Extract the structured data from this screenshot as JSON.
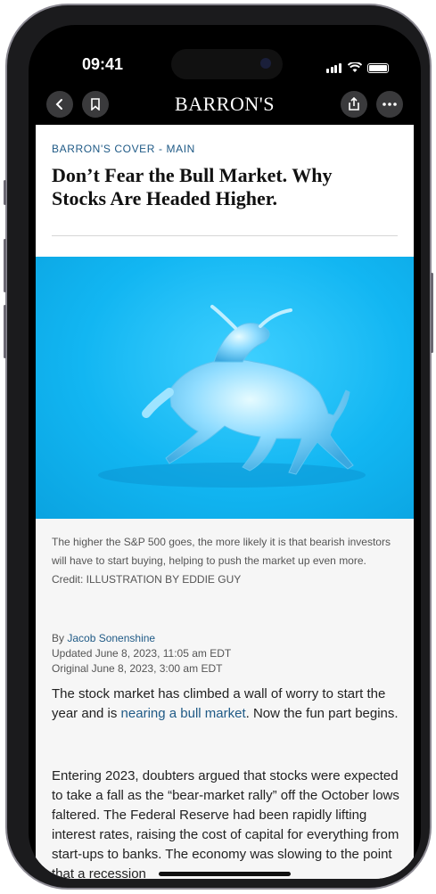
{
  "status": {
    "time": "09:41"
  },
  "nav": {
    "brand": "BARRON'S"
  },
  "article": {
    "kicker": "BARRON'S COVER - MAIN",
    "headline": "Don’t Fear the Bull Market. Why Stocks Are Headed Higher.",
    "caption": "The higher the S&P 500 goes, the more likely it is that bearish investors will have to start buying, helping to push the market up even more. Credit: ILLUSTRATION BY EDDIE GUY",
    "byline_prefix": "By ",
    "author": "Jacob Sonenshine",
    "updated": "Updated June 8, 2023, 11:05 am EDT",
    "original": "Original June 8, 2023, 3:00 am EDT",
    "para1_pre": "The stock market has climbed a wall of worry to start the year and is ",
    "para1_link": "nearing a bull market",
    "para1_post": ". Now the fun part begins.",
    "para2": "Entering 2023, doubters argued that stocks were expected to take a fall as the “bear-market rally” off the October lows faltered. The Federal Reserve had been rapidly lifting interest rates, raising the cost of capital for everything from start-ups to banks. The economy was slowing to the point that a recession"
  },
  "icons": {
    "back": "chevron-left-icon",
    "bookmark": "bookmark-icon",
    "share": "share-icon",
    "more": "more-icon"
  },
  "colors": {
    "link": "#1f5a86",
    "hero_bg": "#12b6f2"
  }
}
